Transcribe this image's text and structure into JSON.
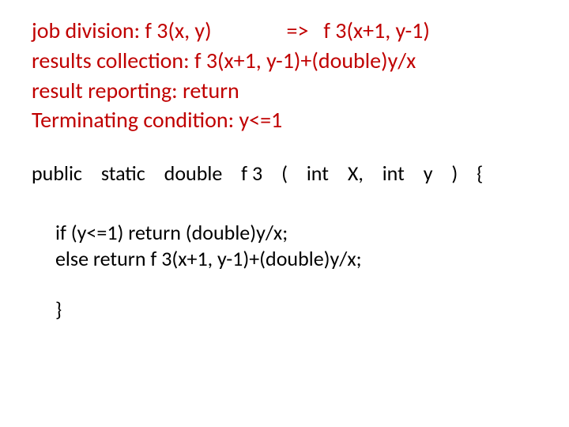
{
  "recursion": {
    "job_division": "job division: f 3(x, y)               =>   f 3(x+1, y-1)",
    "results_collection": "results collection: f 3(x+1, y-1)+(double)y/x",
    "result_reporting": "result reporting: return",
    "terminating_condition": "Terminating condition: y<=1"
  },
  "signature": {
    "w1": "public",
    "w2": "static",
    "w3": "double",
    "w4": "f 3",
    "w5": "(",
    "w6": "int",
    "w7": "X,",
    "w8": "int",
    "w9": "y",
    "w10": ")",
    "w11": "{"
  },
  "body": {
    "if_line": "if (y<=1) return (double)y/x;",
    "else_line": "else return f 3(x+1, y-1)+(double)y/x;",
    "close": "}"
  }
}
